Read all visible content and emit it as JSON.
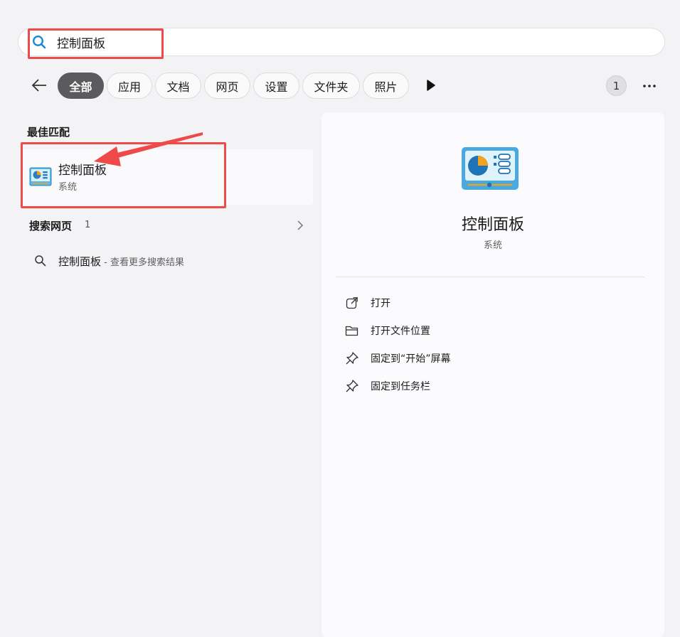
{
  "search": {
    "query": "控制面板"
  },
  "filters": {
    "tabs": [
      {
        "label": "全部"
      },
      {
        "label": "应用"
      },
      {
        "label": "文档"
      },
      {
        "label": "网页"
      },
      {
        "label": "设置"
      },
      {
        "label": "文件夹"
      },
      {
        "label": "照片"
      }
    ],
    "badge": "1"
  },
  "best_match": {
    "section_title": "最佳匹配",
    "title": "控制面板",
    "subtitle": "系统"
  },
  "web_search": {
    "section_title": "搜索网页",
    "count": "1",
    "result_query": "控制面板",
    "result_suffix": " - 查看更多搜索结果"
  },
  "details": {
    "title": "控制面板",
    "subtitle": "系统",
    "actions": [
      {
        "label": "打开",
        "icon": "open-external-icon"
      },
      {
        "label": "打开文件位置",
        "icon": "folder-icon"
      },
      {
        "label": "固定到“开始”屏幕",
        "icon": "pin-icon"
      },
      {
        "label": "固定到任务栏",
        "icon": "pin-icon"
      }
    ]
  },
  "colors": {
    "highlight": "#ef4a4a",
    "active_chip": "#5b5b5e",
    "accent_blue": "#1a8ad4"
  }
}
